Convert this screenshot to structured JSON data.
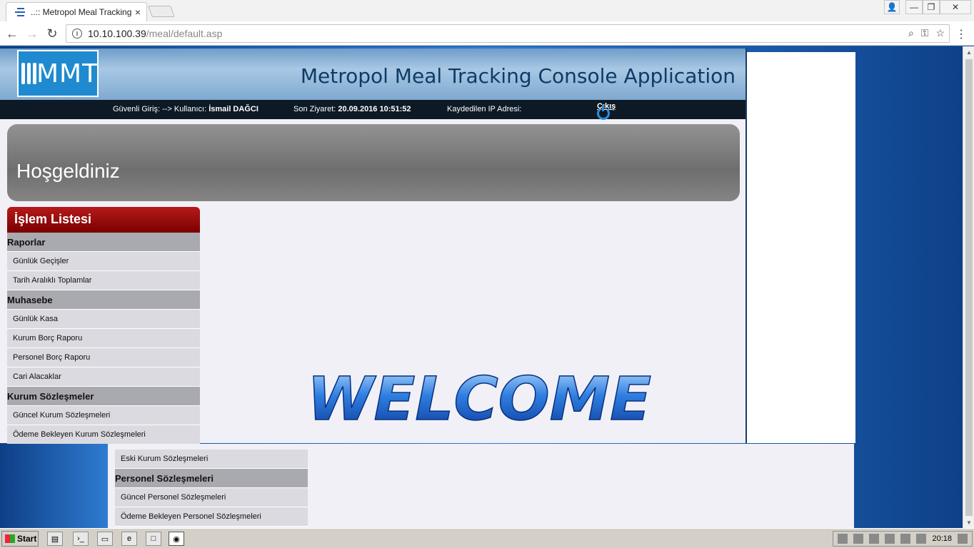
{
  "browser": {
    "tab_title": "..:: Metropol Meal Tracking",
    "tab_close": "×",
    "url_host": "10.10.100.39",
    "url_path": "/meal/default.asp",
    "back": "←",
    "forward": "→",
    "reload": "↻",
    "zoom_icon": "⌕",
    "bookmark_icon": "☆",
    "menu": "⋮"
  },
  "window_controls": {
    "user": "👤",
    "minimize": "—",
    "restore": "❐",
    "close": "✕"
  },
  "header": {
    "logo_text": "MMT",
    "app_title": "Metropol Meal Tracking Console Application"
  },
  "infobar": {
    "secure_login_label": "Güvenli Giriş: --> Kullanıcı:",
    "user_name": "İsmail DAĞCI",
    "last_visit_label": "Son Ziyaret:",
    "last_visit_value": "20.09.2016 10:51:52",
    "ip_label": "Kaydedilen IP Adresi:",
    "logout_label": "Çıkış"
  },
  "welcome_banner": {
    "text": "Hoşgeldiniz"
  },
  "sidepanel": {
    "title": "İşlem Listesi",
    "raporlar": "Raporlar",
    "gunluk_gecisler": "Günlük Geçişler",
    "tarih_aralikli": "Tarih Aralıklı Toplamlar",
    "muhasebe": "Muhasebe",
    "gunluk_kasa": "Günlük Kasa",
    "kurum_borc": "Kurum Borç Raporu",
    "personel_borc": "Personel Borç Raporu",
    "cari_alacaklar": "Cari Alacaklar",
    "kurum_sozlesmeler": "Kurum Sözleşmeler",
    "guncel_kurum": "Güncel Kurum Sözleşmeleri",
    "odeme_bekleyen_kurum": "Ödeme Bekleyen Kurum Sözleşmeleri"
  },
  "lower_panel": {
    "eski_kurum": "Eski Kurum Sözleşmeleri",
    "personel_sozlesmeleri": "Personel Sözleşmeleri",
    "guncel_personel": "Güncel Personel Sözleşmeleri",
    "odeme_bekleyen_personel": "Ödeme Bekleyen Personel Sözleşmeleri"
  },
  "welcome_graphic": {
    "text": "WELCOME"
  },
  "taskbar": {
    "start": "Start",
    "clock": "20:18"
  }
}
